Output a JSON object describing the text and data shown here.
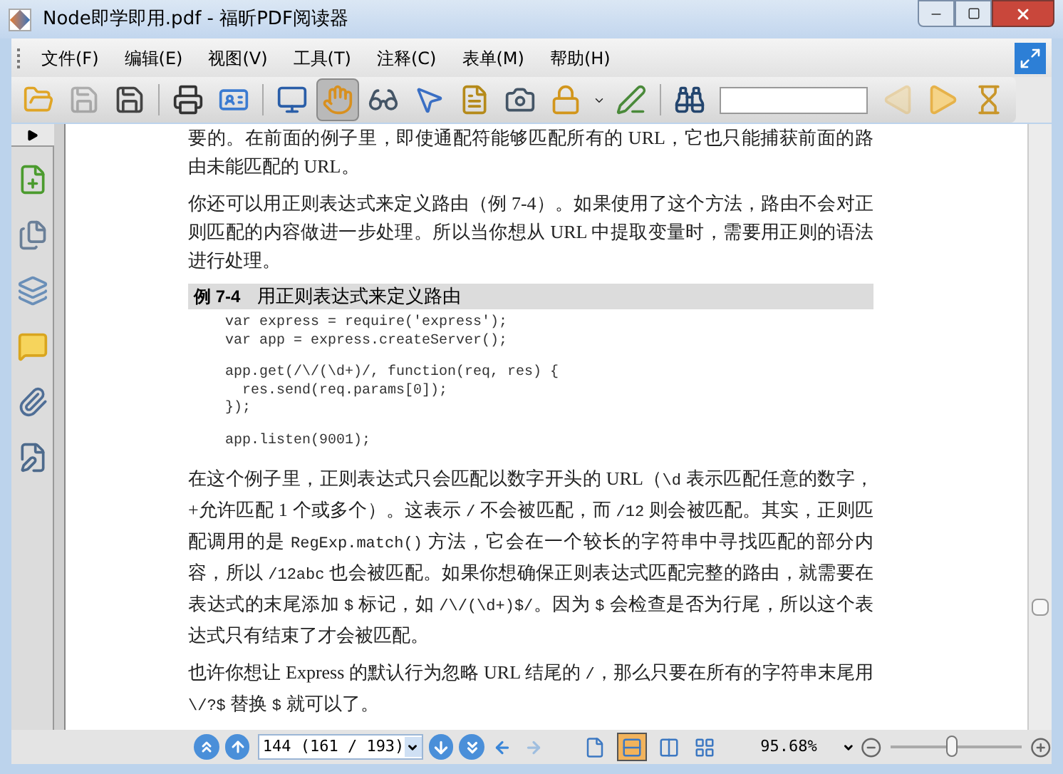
{
  "window": {
    "title": "Node即学即用.pdf - 福昕PDF阅读器"
  },
  "menu": [
    {
      "label": "文件(F)"
    },
    {
      "label": "编辑(E)"
    },
    {
      "label": "视图(V)"
    },
    {
      "label": "工具(T)"
    },
    {
      "label": "注释(C)"
    },
    {
      "label": "表单(M)"
    },
    {
      "label": "帮助(H)"
    }
  ],
  "toolbar": {
    "tools": [
      {
        "selected": false,
        "disabled": false
      },
      {
        "selected": false,
        "disabled": true
      },
      {
        "selected": false,
        "disabled": false
      },
      {
        "selected": false,
        "disabled": false
      },
      {
        "selected": false,
        "disabled": false
      },
      {
        "selected": false,
        "disabled": false
      },
      {
        "selected": true,
        "disabled": false
      },
      {
        "selected": false,
        "disabled": false
      },
      {
        "selected": false,
        "disabled": false
      },
      {
        "selected": false,
        "disabled": false
      },
      {
        "selected": false,
        "disabled": false
      },
      {
        "selected": false,
        "disabled": false
      },
      {
        "selected": false,
        "disabled": false
      },
      {
        "selected": false,
        "disabled": false
      },
      {
        "selected": false,
        "disabled": false
      },
      {
        "selected": false,
        "disabled": true
      },
      {
        "selected": false,
        "disabled": false
      },
      {
        "selected": false,
        "disabled": false
      }
    ]
  },
  "document": {
    "blocks": [
      {
        "kind": "paragraph",
        "segments": [
          {
            "kind": "text",
            "text": "要的。在前面的例子里，即使通配符能够匹配所有的 URL，它也只能捕获前面的路由未能匹配的 URL。"
          }
        ]
      },
      {
        "kind": "paragraph",
        "segments": [
          {
            "kind": "text",
            "text": "你还可以用正则表达式来定义路由（例 7-4）。如果使用了这个方法，路由不会对正则匹配的内容做进一步处理。所以当你想从 URL 中提取变量时，需要用正则的语法进行处理。"
          }
        ]
      },
      {
        "kind": "example",
        "label": "例 7-4",
        "title": "用正则表达式来定义路由"
      },
      {
        "kind": "code",
        "groups": [
          [
            "var express = require('express');",
            "var app = express.createServer();"
          ],
          [
            "app.get(/\\/(\\d+)/, function(req, res) {",
            "  res.send(req.params[0]);",
            "});"
          ],
          [
            "app.listen(9001);"
          ]
        ]
      },
      {
        "kind": "paragraph",
        "segments": [
          {
            "kind": "text",
            "text": "在这个例子里，正则表达式只会匹配以数字开头的 URL（"
          },
          {
            "kind": "code",
            "text": "\\d"
          },
          {
            "kind": "text",
            "text": " 表示匹配任意的数字，+允许匹配 1 个或多个）。这表示 "
          },
          {
            "kind": "code",
            "text": "/"
          },
          {
            "kind": "text",
            "text": " 不会被匹配，而 "
          },
          {
            "kind": "code",
            "text": "/12"
          },
          {
            "kind": "text",
            "text": " 则会被匹配。其实，正则匹配调用的是 "
          },
          {
            "kind": "code",
            "text": "RegExp.match()"
          },
          {
            "kind": "text",
            "text": " 方法，它会在一个较长的字符串中寻找匹配的部分内容，所以 "
          },
          {
            "kind": "code",
            "text": "/12abc"
          },
          {
            "kind": "text",
            "text": " 也会被匹配。如果你想确保正则表达式匹配完整的路由，就需要在表达式的末尾添加 "
          },
          {
            "kind": "code",
            "text": "$"
          },
          {
            "kind": "text",
            "text": " 标记，如 "
          },
          {
            "kind": "code",
            "text": "/\\/(\\d+)$/"
          },
          {
            "kind": "text",
            "text": "。因为 "
          },
          {
            "kind": "code",
            "text": "$"
          },
          {
            "kind": "text",
            "text": " 会检查是否为行尾，所以这个表达式只有结束了才会被匹配。"
          }
        ]
      },
      {
        "kind": "paragraph",
        "segments": [
          {
            "kind": "text",
            "text": "也许你想让 Express 的默认行为忽略 URL 结尾的 "
          },
          {
            "kind": "code",
            "text": "/"
          },
          {
            "kind": "text",
            "text": "，那么只要在所有的字符串末尾用 "
          },
          {
            "kind": "code",
            "text": "\\/?$"
          },
          {
            "kind": "text",
            "text": " 替换 "
          },
          {
            "kind": "code",
            "text": "$"
          },
          {
            "kind": "text",
            "text": " 就可以了。"
          }
        ]
      }
    ]
  },
  "status_bar": {
    "nav": [
      {
        "disabled": false
      },
      {
        "disabled": false
      }
    ],
    "page": "144 (161 / 193)",
    "nav_after": [
      {
        "disabled": false
      },
      {
        "disabled": false
      },
      {
        "disabled": false
      },
      {
        "disabled": true
      }
    ],
    "views": [
      {
        "selected": false
      },
      {
        "selected": true
      },
      {
        "selected": false
      },
      {
        "selected": false
      }
    ],
    "zoom": "95.68%",
    "zoom_slider": {
      "level": 0.47
    }
  }
}
